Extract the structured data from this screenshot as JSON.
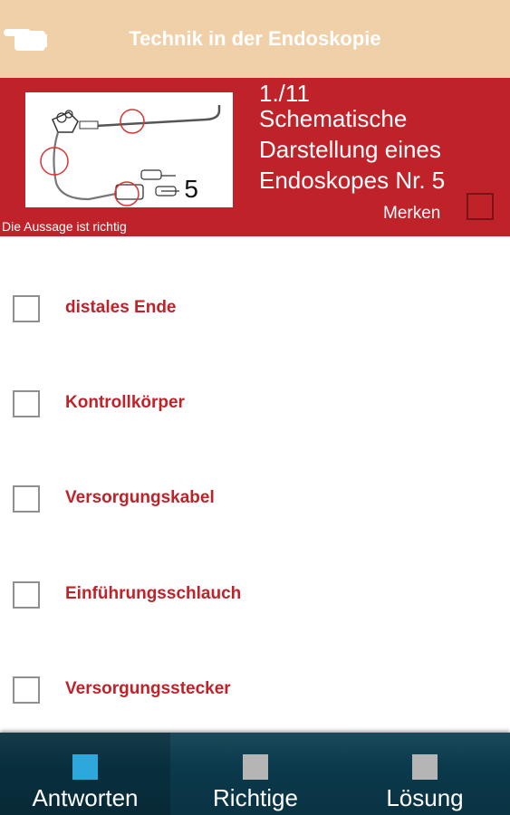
{
  "header": {
    "title": "Technik in der Endoskopie",
    "back_icon": "pointing-hand-back-icon"
  },
  "question": {
    "counter": "1./11",
    "text": "Schematische Darstellung eines Endoskopes Nr. 5",
    "image_number": "5",
    "statement_label": "Die Aussage ist richtig",
    "merken_label": "Merken"
  },
  "answers": [
    {
      "label": "distales Ende"
    },
    {
      "label": "Kontrollkörper"
    },
    {
      "label": "Versorgungskabel"
    },
    {
      "label": "Einführungsschlauch"
    },
    {
      "label": "Versorgungsstecker"
    }
  ],
  "tabs": [
    {
      "label": "Antworten",
      "color": "#2ea7dc",
      "active": true
    },
    {
      "label": "Richtige",
      "color": "#b5b5b5",
      "active": false
    },
    {
      "label": "Lösung",
      "color": "#b5b5b5",
      "active": false
    }
  ],
  "colors": {
    "header_bg": "#efd0a8",
    "question_bg": "#c0222a",
    "answer_text": "#c0222a",
    "bottom_bar": "#0a3a4c"
  }
}
